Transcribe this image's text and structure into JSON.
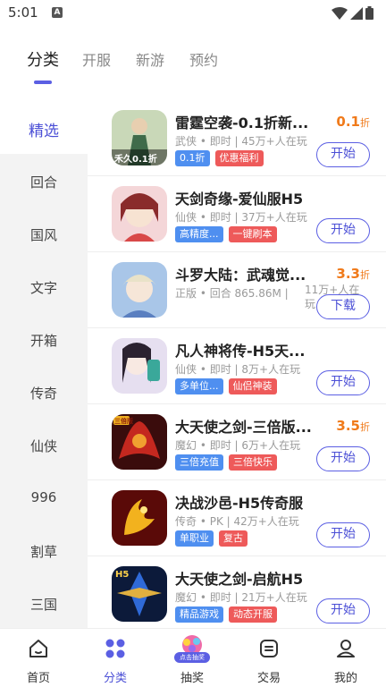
{
  "status_bar": {
    "time": "5:01",
    "notification_letter": "A"
  },
  "top_tabs": [
    {
      "label": "分类",
      "active": true
    },
    {
      "label": "开服",
      "active": false
    },
    {
      "label": "新游",
      "active": false
    },
    {
      "label": "预约",
      "active": false
    }
  ],
  "sidebar": {
    "items": [
      "精选",
      "回合",
      "国风",
      "文字",
      "开箱",
      "传奇",
      "仙侠",
      "996",
      "割草",
      "三国"
    ],
    "selected": "精选"
  },
  "games": [
    {
      "title": "雷霆空袭-0.1折新...",
      "meta": "武侠 • 即时 | 45万+人在玩",
      "players": "",
      "tags": [
        {
          "text": "0.1折",
          "color": "blue"
        },
        {
          "text": "优惠福利",
          "color": "red"
        }
      ],
      "discount_value": "0.1",
      "discount_unit": "折",
      "button": "开始",
      "icon_text": "禾久0.1折"
    },
    {
      "title": "天剑奇缘-爱仙服H5",
      "meta": "仙侠 • 即时 | 37万+人在玩",
      "players": "",
      "tags": [
        {
          "text": "高精度...",
          "color": "blue"
        },
        {
          "text": "一键刷本",
          "color": "red"
        }
      ],
      "discount_value": "",
      "discount_unit": "",
      "button": "开始",
      "icon_text": ""
    },
    {
      "title": "斗罗大陆：武魂觉...",
      "meta": "正版 • 回合   865.86M |",
      "players": "11万+人在玩",
      "tags": [],
      "discount_value": "3.3",
      "discount_unit": "折",
      "button": "下载",
      "icon_text": ""
    },
    {
      "title": "凡人神将传-H5天...",
      "meta": "仙侠 • 即时 | 8万+人在玩",
      "players": "",
      "tags": [
        {
          "text": "多单位...",
          "color": "blue"
        },
        {
          "text": "仙侣神装",
          "color": "red"
        }
      ],
      "discount_value": "",
      "discount_unit": "",
      "button": "开始",
      "icon_text": ""
    },
    {
      "title": "大天使之剑-三倍版...",
      "meta": "魔幻 • 即时 | 6万+人在玩",
      "players": "",
      "tags": [
        {
          "text": "三倍充值",
          "color": "blue"
        },
        {
          "text": "三倍快乐",
          "color": "red"
        }
      ],
      "discount_value": "3.5",
      "discount_unit": "折",
      "button": "开始",
      "icon_text": "三倍版"
    },
    {
      "title": "决战沙邑-H5传奇服",
      "meta": "传奇 • PK | 42万+人在玩",
      "players": "",
      "tags": [
        {
          "text": "单职业",
          "color": "blue"
        },
        {
          "text": "复古",
          "color": "red"
        }
      ],
      "discount_value": "",
      "discount_unit": "",
      "button": "开始",
      "icon_text": ""
    },
    {
      "title": "大天使之剑-启航H5",
      "meta": "魔幻 • 即时 | 21万+人在玩",
      "players": "",
      "tags": [
        {
          "text": "精品游戏",
          "color": "blue"
        },
        {
          "text": "动态开服",
          "color": "red"
        }
      ],
      "discount_value": "",
      "discount_unit": "",
      "button": "开始",
      "icon_text": "H5"
    }
  ],
  "bottom_nav": [
    {
      "label": "首页",
      "icon": "home-icon",
      "active": false
    },
    {
      "label": "分类",
      "icon": "category-icon",
      "active": true
    },
    {
      "label": "抽奖",
      "icon": "lottery-icon",
      "active": false,
      "badge": "点击抽奖"
    },
    {
      "label": "交易",
      "icon": "trade-icon",
      "active": false
    },
    {
      "label": "我的",
      "icon": "profile-icon",
      "active": false
    }
  ],
  "colors": {
    "accent": "#5b5fe3",
    "discount": "#f07a1a",
    "tag_blue": "#4f8ff0",
    "tag_red": "#ee5a5a"
  }
}
